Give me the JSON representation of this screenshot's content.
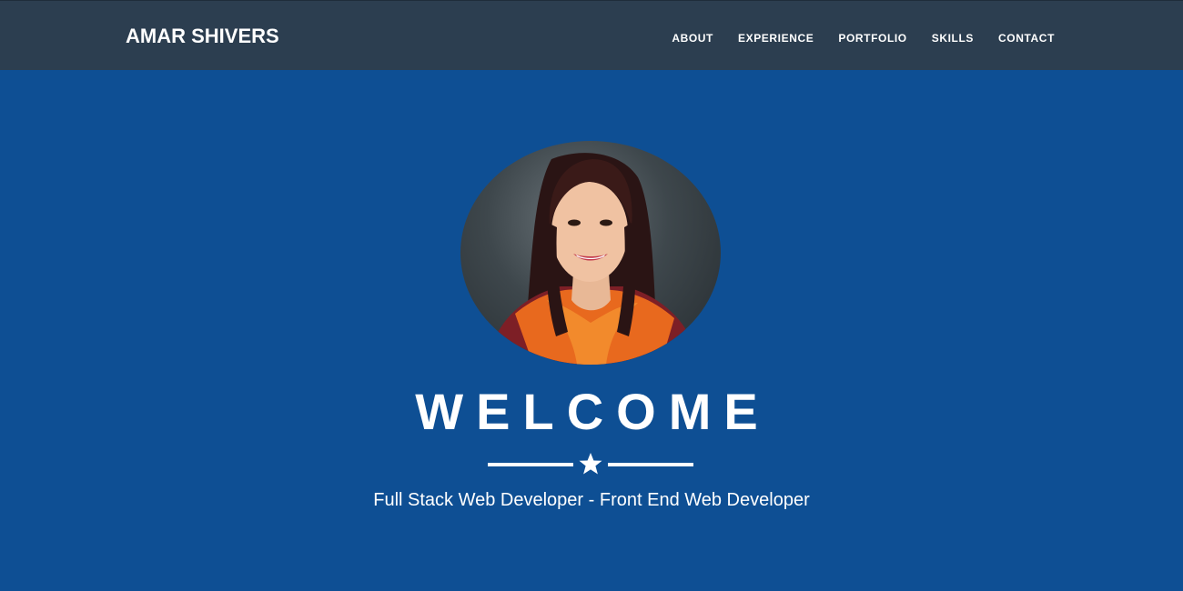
{
  "navbar": {
    "brand": "AMAR SHIVERS",
    "links": [
      {
        "label": "ABOUT"
      },
      {
        "label": "EXPERIENCE"
      },
      {
        "label": "PORTFOLIO"
      },
      {
        "label": "SKILLS"
      },
      {
        "label": "CONTACT"
      }
    ]
  },
  "hero": {
    "title": "WELCOME",
    "divider_icon": "star-icon",
    "subtitle": "Full Stack Web Developer - Front End Web Developer"
  },
  "colors": {
    "navbar_bg": "#2c3e50",
    "hero_bg": "#0e4f94",
    "text": "#ffffff"
  }
}
